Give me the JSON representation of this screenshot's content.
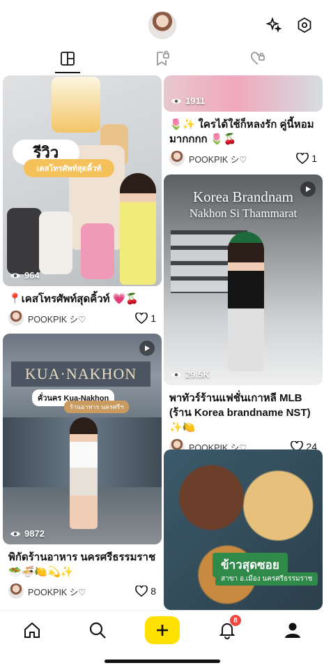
{
  "header": {
    "icons": [
      "profile-avatar",
      "sparkle-icon",
      "settings-icon"
    ]
  },
  "tabs": [
    {
      "name": "grid",
      "icon": "grid-icon",
      "active": true
    },
    {
      "name": "saved",
      "icon": "bookmark-lock-icon",
      "active": false
    },
    {
      "name": "liked",
      "icon": "heart-lock-icon",
      "active": false
    }
  ],
  "posts": {
    "review": {
      "views": "964",
      "overlay_title": "รีวิว",
      "overlay_sub": "เคสโทรศัพท์สุดคิ้วท์",
      "caption": "📍เคสโทรศัพท์สุดคิ้วท์ 💗🍒",
      "author": "POOKPIK シ♡",
      "likes": "1"
    },
    "top_right": {
      "views": "1911",
      "caption": "🌷✨ ใครได้ใช้ก็หลงรัก คู่นี้หอมมากกกก 🌷🍒",
      "author": "POOKPIK シ♡",
      "likes": "1"
    },
    "korea": {
      "overlay_title1": "Korea Brandnam",
      "overlay_title2": "Nakhon Si Thammarat",
      "views": "29.5K",
      "caption": "พาทัวร์ร้านแฟชั่นเกาหลี MLB (ร้าน Korea brandname NST) ✨🍋",
      "author": "POOKPIK シ♡",
      "likes": "24"
    },
    "kua": {
      "sign": "KUA·NAKHON",
      "tag": "คั่วนคร Kua-Nakhon",
      "tag2": "ร้านอาหาร นครศรีฯ",
      "views": "9872",
      "caption": "พิกัดร้านอาหาร นครศรีธรรมราช 🥗🍜🍋💫✨",
      "author": "POOKPIK シ♡",
      "likes": "8"
    },
    "food": {
      "banner": "ข้าวสุดซอย",
      "banner2": "สาขา อ.เมือง นครศรีธรรมราช"
    }
  },
  "bottom_nav": {
    "notification_count": "8"
  }
}
